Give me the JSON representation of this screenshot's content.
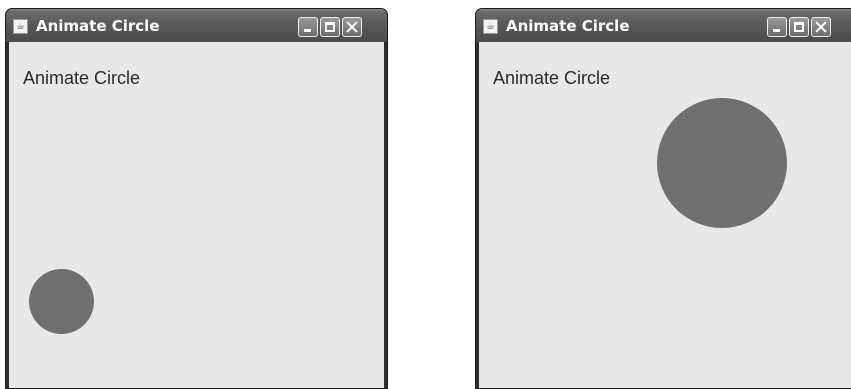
{
  "windows": [
    {
      "id": "left",
      "title": "Animate Circle",
      "content_label": "Animate Circle",
      "circle_color": "#707070"
    },
    {
      "id": "right",
      "title": "Animate Circle",
      "content_label": "Animate Circle",
      "circle_color": "#707070"
    }
  ],
  "colors": {
    "titlebar": "#585858",
    "panel_background": "#e8e8e8",
    "circle": "#707070"
  },
  "icons": {
    "app": "java-cup-icon",
    "minimize": "minimize-icon",
    "maximize": "maximize-icon",
    "close": "close-icon"
  }
}
